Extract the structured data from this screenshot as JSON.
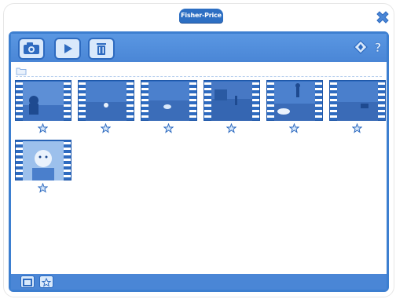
{
  "app": {
    "logo_text": "Fisher-Price",
    "accent_color": "#3d7fd0",
    "toolbar_color": "#4a86d6"
  },
  "toolbar": {
    "left_buttons": [
      {
        "icon": "camera-icon"
      },
      {
        "icon": "play-icon"
      },
      {
        "icon": "trash-icon"
      }
    ],
    "right_icons": [
      {
        "icon": "diamond-arrows-icon"
      },
      {
        "icon": "help-question-icon"
      }
    ]
  },
  "folder_path": {
    "icon": "folder-icon"
  },
  "thumbnails": [
    {
      "type": "video",
      "scene": "baby-sitting-on-grass",
      "favorite_icon": "star-icon"
    },
    {
      "type": "video",
      "scene": "yard-with-ball",
      "favorite_icon": "star-icon"
    },
    {
      "type": "video",
      "scene": "dog-on-grass",
      "favorite_icon": "star-icon"
    },
    {
      "type": "video",
      "scene": "yard-with-fence",
      "favorite_icon": "star-icon"
    },
    {
      "type": "video",
      "scene": "person-in-yard",
      "favorite_icon": "star-icon"
    },
    {
      "type": "video",
      "scene": "yard-with-toy",
      "favorite_icon": "star-icon"
    },
    {
      "type": "video",
      "scene": "baby-portrait",
      "favorite_icon": "star-icon"
    }
  ],
  "bottom_bar": {
    "buttons": [
      {
        "icon": "photo-album-icon"
      },
      {
        "icon": "favorites-star-folder-icon"
      }
    ]
  }
}
